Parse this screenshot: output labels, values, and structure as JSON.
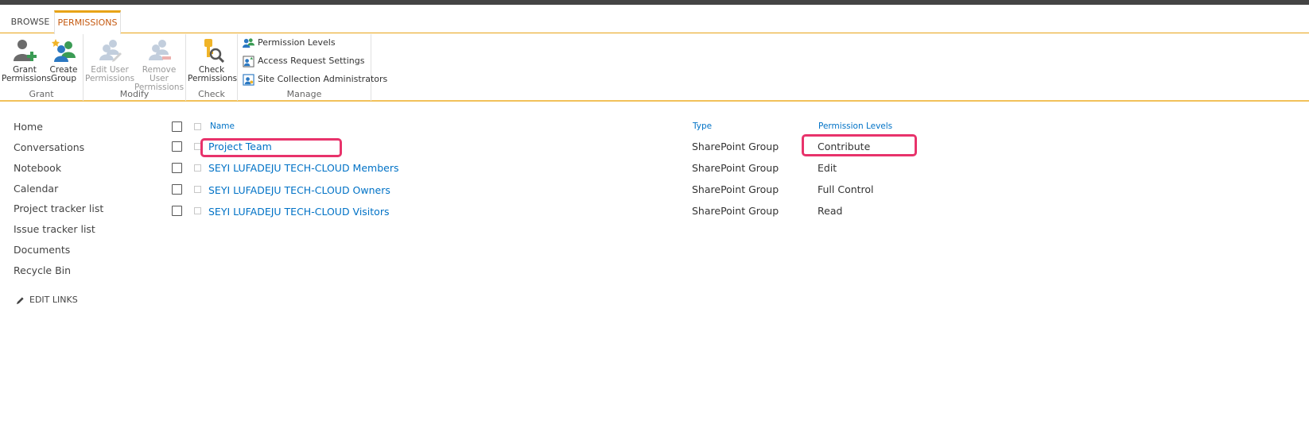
{
  "tabs": {
    "browse": "BROWSE",
    "permissions": "PERMISSIONS"
  },
  "ribbon": {
    "grant": {
      "label": "Grant",
      "grant_permissions": [
        "Grant",
        "Permissions"
      ],
      "create_group": [
        "Create",
        "Group"
      ]
    },
    "modify": {
      "label": "Modify",
      "edit_user_permissions": [
        "Edit User",
        "Permissions"
      ],
      "remove_user_permissions": [
        "Remove User",
        "Permissions"
      ]
    },
    "check": {
      "label": "Check",
      "check_permissions": [
        "Check",
        "Permissions"
      ]
    },
    "manage": {
      "label": "Manage",
      "permission_levels": "Permission Levels",
      "access_request_settings": "Access Request Settings",
      "site_collection_administrators": "Site Collection Administrators"
    }
  },
  "nav": {
    "items": [
      "Home",
      "Conversations",
      "Notebook",
      "Calendar",
      "Project tracker list",
      "Issue tracker list",
      "Documents",
      "Recycle Bin"
    ],
    "edit_links": "EDIT LINKS"
  },
  "table": {
    "headers": {
      "name": "Name",
      "type": "Type",
      "permission_levels": "Permission Levels"
    },
    "rows": [
      {
        "name": "Project Team",
        "type": "SharePoint Group",
        "level": "Contribute"
      },
      {
        "name": "SEYI LUFADEJU TECH-CLOUD Members",
        "type": "SharePoint Group",
        "level": "Edit"
      },
      {
        "name": "SEYI LUFADEJU TECH-CLOUD Owners",
        "type": "SharePoint Group",
        "level": "Full Control"
      },
      {
        "name": "SEYI LUFADEJU TECH-CLOUD Visitors",
        "type": "SharePoint Group",
        "level": "Read"
      }
    ]
  },
  "colors": {
    "accent": "#e8a317",
    "link": "#0072c6",
    "highlight": "#e8336b"
  }
}
